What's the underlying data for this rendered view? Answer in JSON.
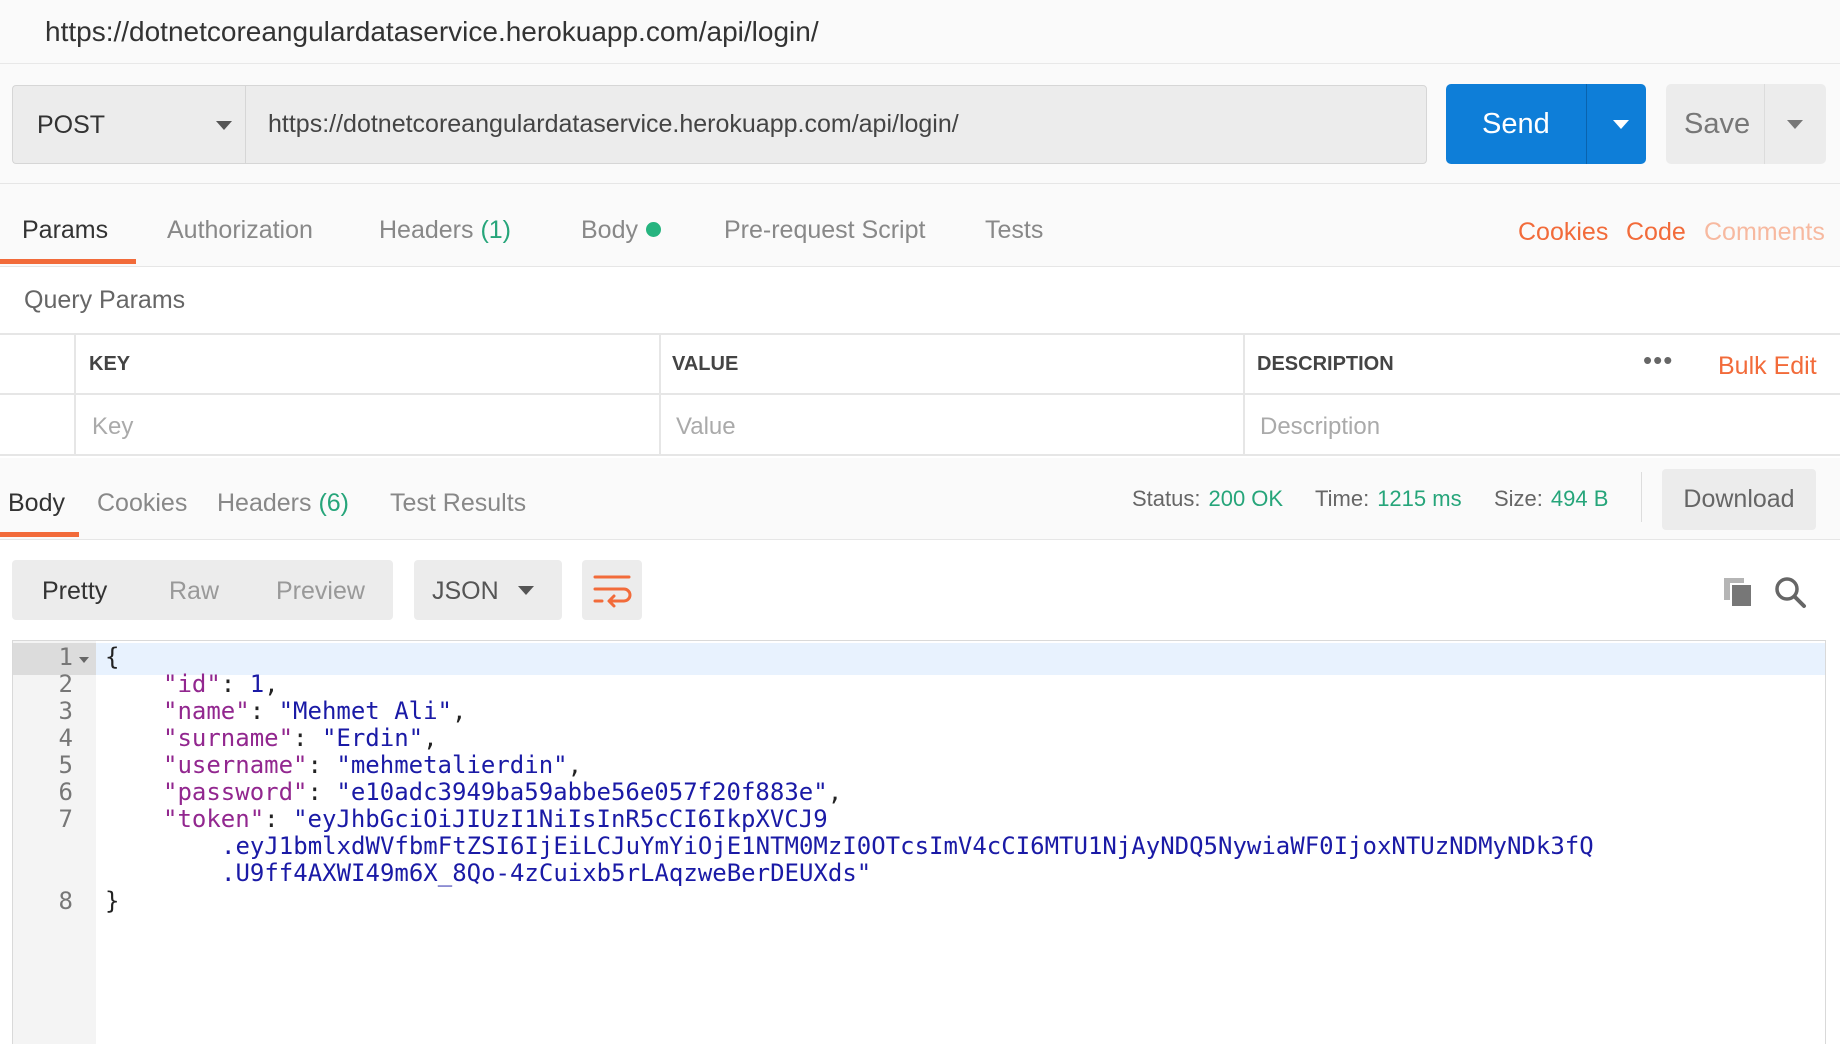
{
  "window": {
    "url_title": "https://dotnetcoreangulardataservice.herokuapp.com/api/login/"
  },
  "request": {
    "method": "POST",
    "url": "https://dotnetcoreangulardataservice.herokuapp.com/api/login/",
    "send_label": "Send",
    "save_label": "Save"
  },
  "request_tabs": {
    "params": "Params",
    "authorization": "Authorization",
    "headers": "Headers",
    "headers_count": "(1)",
    "body": "Body",
    "prerequest": "Pre-request Script",
    "tests": "Tests",
    "cookies_link": "Cookies",
    "code_link": "Code",
    "comments_link": "Comments"
  },
  "query_params": {
    "title": "Query Params",
    "col_key": "KEY",
    "col_value": "VALUE",
    "col_description": "DESCRIPTION",
    "more": "•••",
    "bulk_edit": "Bulk Edit",
    "ph_key": "Key",
    "ph_value": "Value",
    "ph_description": "Description"
  },
  "response_tabs": {
    "body": "Body",
    "cookies": "Cookies",
    "headers": "Headers",
    "headers_count": "(6)",
    "test_results": "Test Results"
  },
  "response_meta": {
    "status_label": "Status:",
    "status_value": "200 OK",
    "time_label": "Time:",
    "time_value": "1215 ms",
    "size_label": "Size:",
    "size_value": "494 B",
    "download": "Download"
  },
  "view": {
    "pretty": "Pretty",
    "raw": "Raw",
    "preview": "Preview",
    "format": "JSON"
  },
  "icons": {
    "wrap": "wrap-lines-icon",
    "copy": "copy-icon",
    "search": "search-icon"
  },
  "colors": {
    "accent_orange": "#f26b3a",
    "send_blue": "#0e7ed8",
    "status_green": "#26a57a"
  },
  "response_body": {
    "line_numbers": [
      "1",
      "2",
      "3",
      "4",
      "5",
      "6",
      "7",
      "8"
    ],
    "open_brace": "{",
    "close_brace": "}",
    "id_key": "\"id\"",
    "id_value": "1",
    "name_key": "\"name\"",
    "name_value": "\"Mehmet Ali\"",
    "surname_key": "\"surname\"",
    "surname_value": "\"Erdin\"",
    "username_key": "\"username\"",
    "username_value": "\"mehmetalierdin\"",
    "password_key": "\"password\"",
    "password_value": "\"e10adc3949ba59abbe56e057f20f883e\"",
    "token_key": "\"token\"",
    "token_line1": "\"eyJhbGciOiJIUzI1NiIsInR5cCI6IkpXVCJ9",
    "token_line2": ".eyJ1bmlxdWVfbmFtZSI6IjEiLCJuYmYiOjE1NTM0MzI0OTcsImV4cCI6MTU1NjAyNDQ5NywiaWF0IjoxNTUzNDMyNDk3fQ",
    "token_line3": ".U9ff4AXWI49m6X_8Qo-4zCuixb5rLAqzweBerDEUXds\""
  }
}
